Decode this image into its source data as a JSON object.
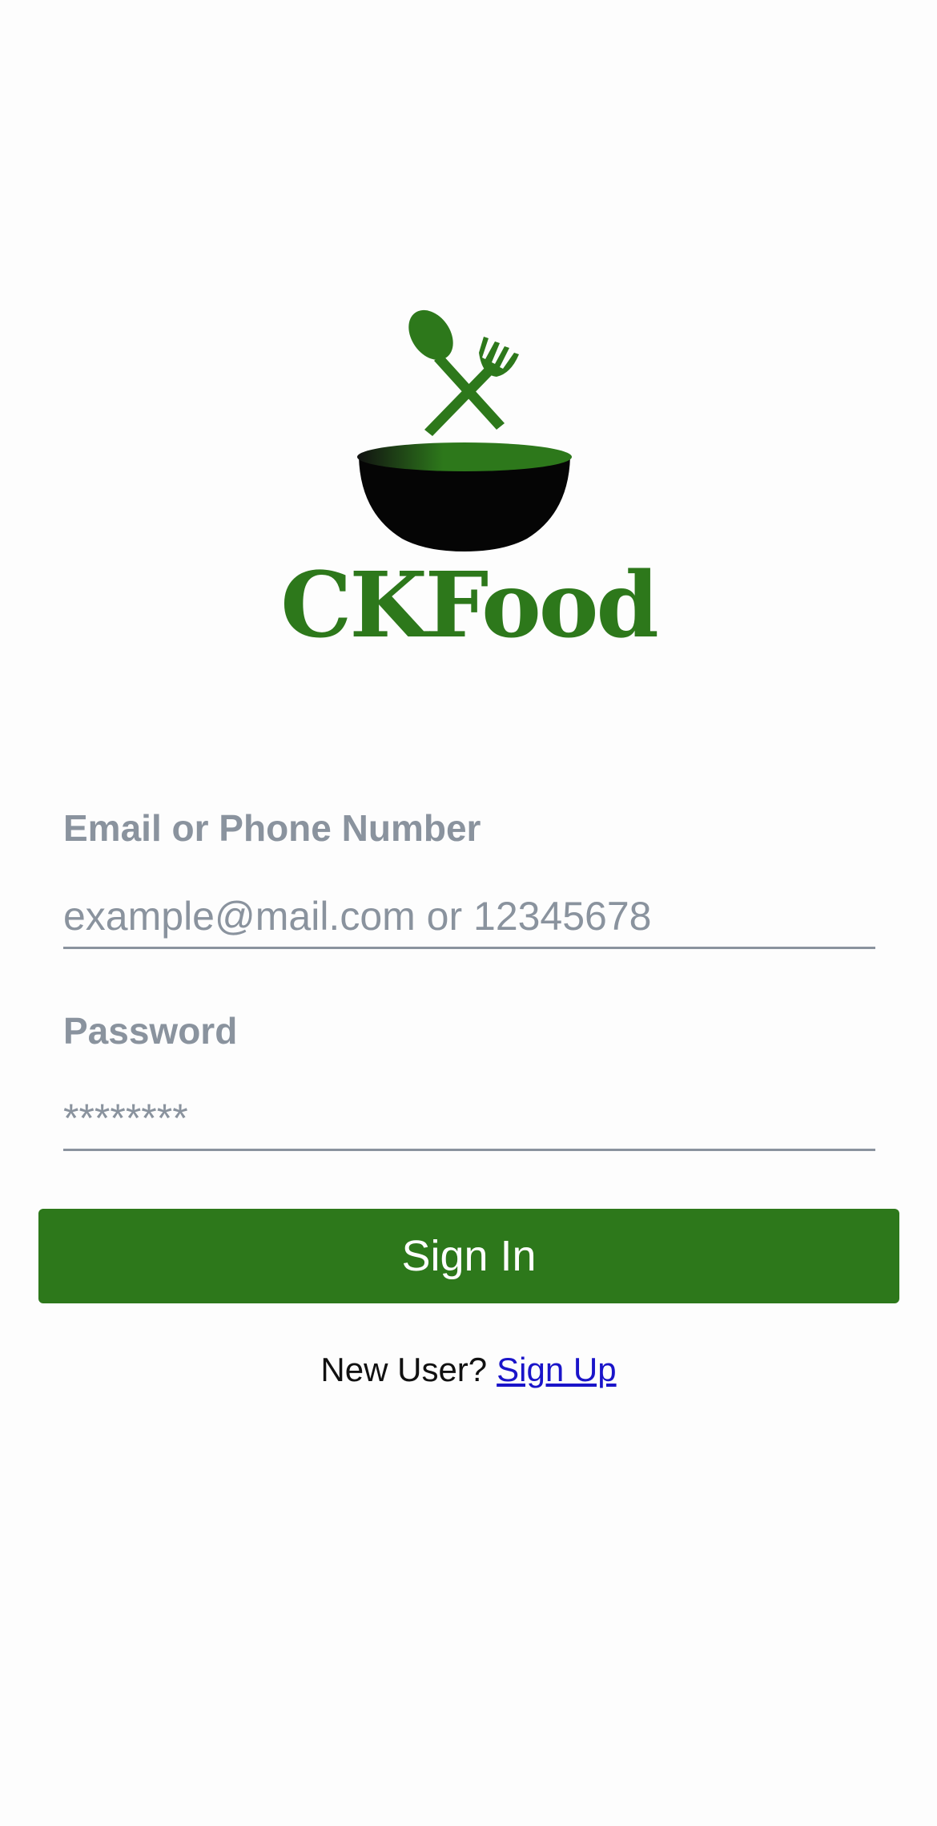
{
  "brand": {
    "name": "CKFood",
    "logo_icon": "bowl-spoon-fork-icon",
    "accent_color": "#2d781b"
  },
  "form": {
    "email": {
      "label": "Email or Phone Number",
      "placeholder": "example@mail.com or 12345678",
      "value": ""
    },
    "password": {
      "label": "Password",
      "placeholder": "********",
      "value": ""
    },
    "submit_label": "Sign In"
  },
  "footer": {
    "prompt": "New User?",
    "link_label": "Sign Up",
    "link_color": "#1a14c9"
  }
}
